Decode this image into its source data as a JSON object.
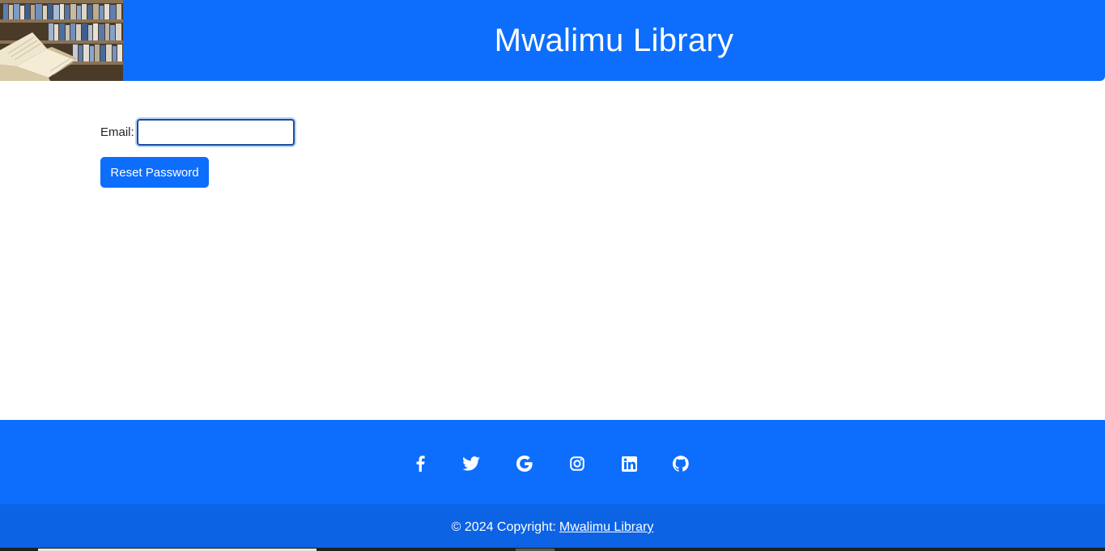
{
  "header": {
    "title": "Mwalimu Library",
    "logo_icon": "library-books-image"
  },
  "form": {
    "email_label": "Email:",
    "email_value": "",
    "email_placeholder": "",
    "reset_button_label": "Reset Password"
  },
  "footer": {
    "social_icons": [
      "facebook-icon",
      "twitter-icon",
      "google-icon",
      "instagram-icon",
      "linkedin-icon",
      "github-icon"
    ],
    "copyright_prefix": "© 2024 Copyright:",
    "copyright_link": "Mwalimu Library"
  },
  "colors": {
    "primary": "#0d6efd",
    "footer_bottom": "#0c63e4",
    "text": "#212529"
  }
}
